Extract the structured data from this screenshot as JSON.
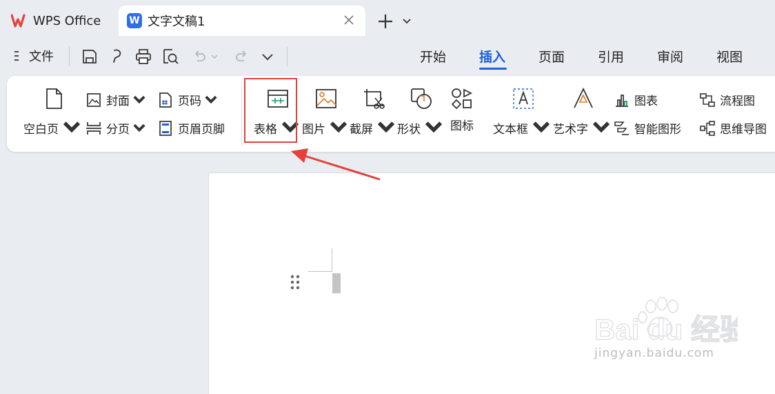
{
  "tabs": {
    "app_tab": "WPS Office",
    "doc_tab": "文字文稿1"
  },
  "toolbar": {
    "menu_label": "文件"
  },
  "ribbon_tabs": [
    "开始",
    "插入",
    "页面",
    "引用",
    "审阅",
    "视图"
  ],
  "active_ribbon_tab": "插入",
  "ribbon": {
    "blank_page": "空白页",
    "cover": "封面",
    "page_break": "分页",
    "page_number": "页码",
    "header_footer": "页眉页脚",
    "table": "表格",
    "picture": "图片",
    "screenshot": "截屏",
    "shape": "形状",
    "icon": "图标",
    "textbox": "文本框",
    "wordart": "艺术字",
    "chart": "图表",
    "smartart": "智能图形",
    "flowchart": "流程图",
    "mindmap": "思维导图"
  },
  "watermark": {
    "brand": "Bai du 经验",
    "url": "jingyan.baidu.com"
  },
  "colors": {
    "accent": "#1f5fd6",
    "highlight": "#e0413a",
    "wps_red": "#e8403a",
    "doc_blue": "#2f6fe4"
  }
}
